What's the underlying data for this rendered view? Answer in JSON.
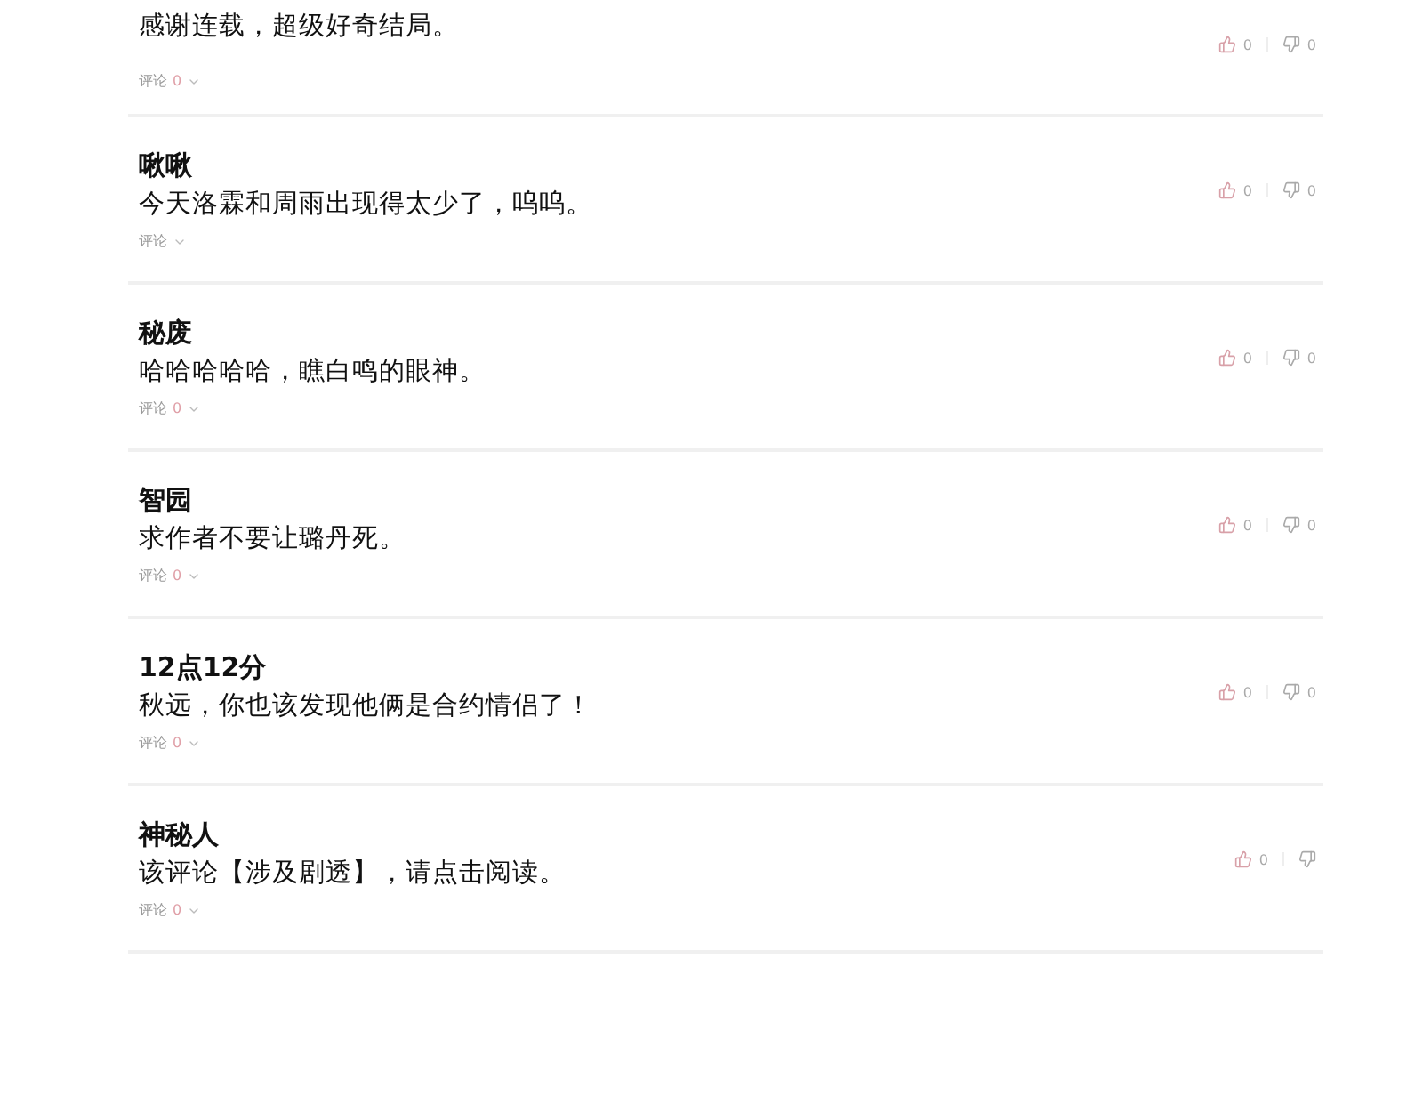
{
  "comments": [
    {
      "text": "感谢连载，超级好奇结局。",
      "reply_label": "评论",
      "reply_count": "0",
      "likes": "0",
      "dislikes": "0"
    },
    {
      "author": "啾啾",
      "text": "今天洛霖和周雨出现得太少了，呜呜。",
      "reply_label": "评论",
      "likes": "0",
      "dislikes": "0"
    },
    {
      "author": "秘废",
      "text": "哈哈哈哈哈，瞧白鸣的眼神。",
      "reply_label": "评论",
      "reply_count": "0",
      "likes": "0",
      "dislikes": "0"
    },
    {
      "author": "智园",
      "text": "求作者不要让璐丹死。",
      "reply_label": "评论",
      "reply_count": "0",
      "likes": "0",
      "dislikes": "0"
    },
    {
      "author": "12点12分",
      "text": "秋远，你也该发现他俩是合约情侣了！",
      "reply_label": "评论",
      "reply_count": "0",
      "likes": "0",
      "dislikes": "0"
    },
    {
      "author": "神秘人",
      "text": "该评论【涉及剧透】，请点击阅读。",
      "reply_label": "评论",
      "reply_count": "0",
      "likes": "0"
    }
  ]
}
